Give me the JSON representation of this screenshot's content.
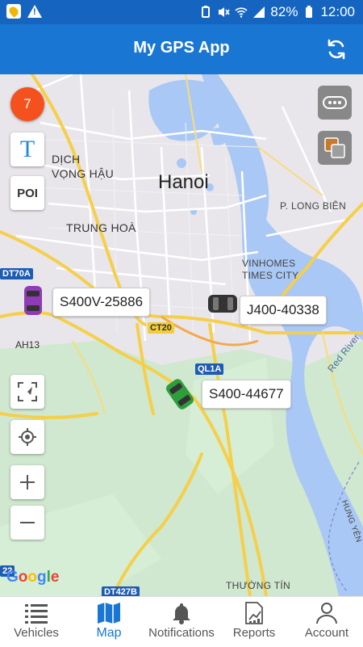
{
  "status_bar": {
    "battery": "82%",
    "time": "12:00",
    "icons": [
      "app-icon",
      "warning-icon",
      "battery-saver-icon",
      "mute-icon",
      "wifi-icon",
      "signal-icon",
      "battery-icon"
    ]
  },
  "header": {
    "title": "My GPS App",
    "action_icon": "refresh-icon"
  },
  "map": {
    "vehicle_count_badge": "7",
    "text_tool_label": "T",
    "poi_label": "POI",
    "places": {
      "dich_vong_hau": "DỊCH\nVỌNG HẬU",
      "hanoi": "Hanoi",
      "long_bien": "P. LONG BIÊN",
      "trung_hoa": "TRUNG HOÀ",
      "vinhomes": "VINHOMES\nTIMES CITY",
      "red_river": "Red River",
      "thuong_tin": "THƯỜNG TÍN",
      "hung_yen": "HUNG YÊN"
    },
    "shields": {
      "dt70a": "DT70A",
      "ah13": "AH13",
      "ct20": "CT20",
      "ql1a": "QL1A",
      "dt427b": "DT427B",
      "r22": "22"
    },
    "vehicles": [
      {
        "label": "S400V-25886",
        "color": "#8e3bb5"
      },
      {
        "label": "J400-40338",
        "color": "#333333"
      },
      {
        "label": "S400-44677",
        "color": "#2e9e3a"
      }
    ],
    "attribution": "Google"
  },
  "bottom_nav": [
    {
      "label": "Vehicles",
      "icon": "list-icon",
      "active": false
    },
    {
      "label": "Map",
      "icon": "map-icon",
      "active": true
    },
    {
      "label": "Notifications",
      "icon": "bell-icon",
      "active": false
    },
    {
      "label": "Reports",
      "icon": "report-icon",
      "active": false
    },
    {
      "label": "Account",
      "icon": "person-icon",
      "active": false
    }
  ],
  "colors": {
    "primary": "#1976d2",
    "status_bar": "#1565c0",
    "badge": "#f4511e",
    "water": "#aac8f5",
    "park": "#c8e6c9",
    "road": "#ffd54f"
  }
}
